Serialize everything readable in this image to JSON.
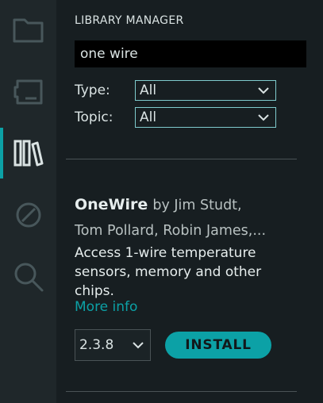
{
  "activity_bar": {
    "items": [
      {
        "icon": "folder-icon"
      },
      {
        "icon": "board-icon"
      },
      {
        "icon": "library-icon",
        "active": true
      },
      {
        "icon": "debug-icon"
      },
      {
        "icon": "search-icon"
      }
    ]
  },
  "library_manager": {
    "title": "LIBRARY MANAGER",
    "search_value": "one wire",
    "filters": {
      "type_label": "Type:",
      "type_value": "All",
      "topic_label": "Topic:",
      "topic_value": "All"
    },
    "result": {
      "name": "OneWire",
      "author_line_1": "by Jim Studt,",
      "author_line_2": "Tom Pollard, Robin James,...",
      "description": "Access 1-wire temperature sensors, memory and other chips.",
      "more_info": "More info",
      "version": "2.3.8",
      "install_label": "INSTALL"
    }
  },
  "colors": {
    "accent": "#0ca1a6",
    "background": "#171e21",
    "activity_bar": "#1f272a",
    "text": "#dae3e3"
  }
}
